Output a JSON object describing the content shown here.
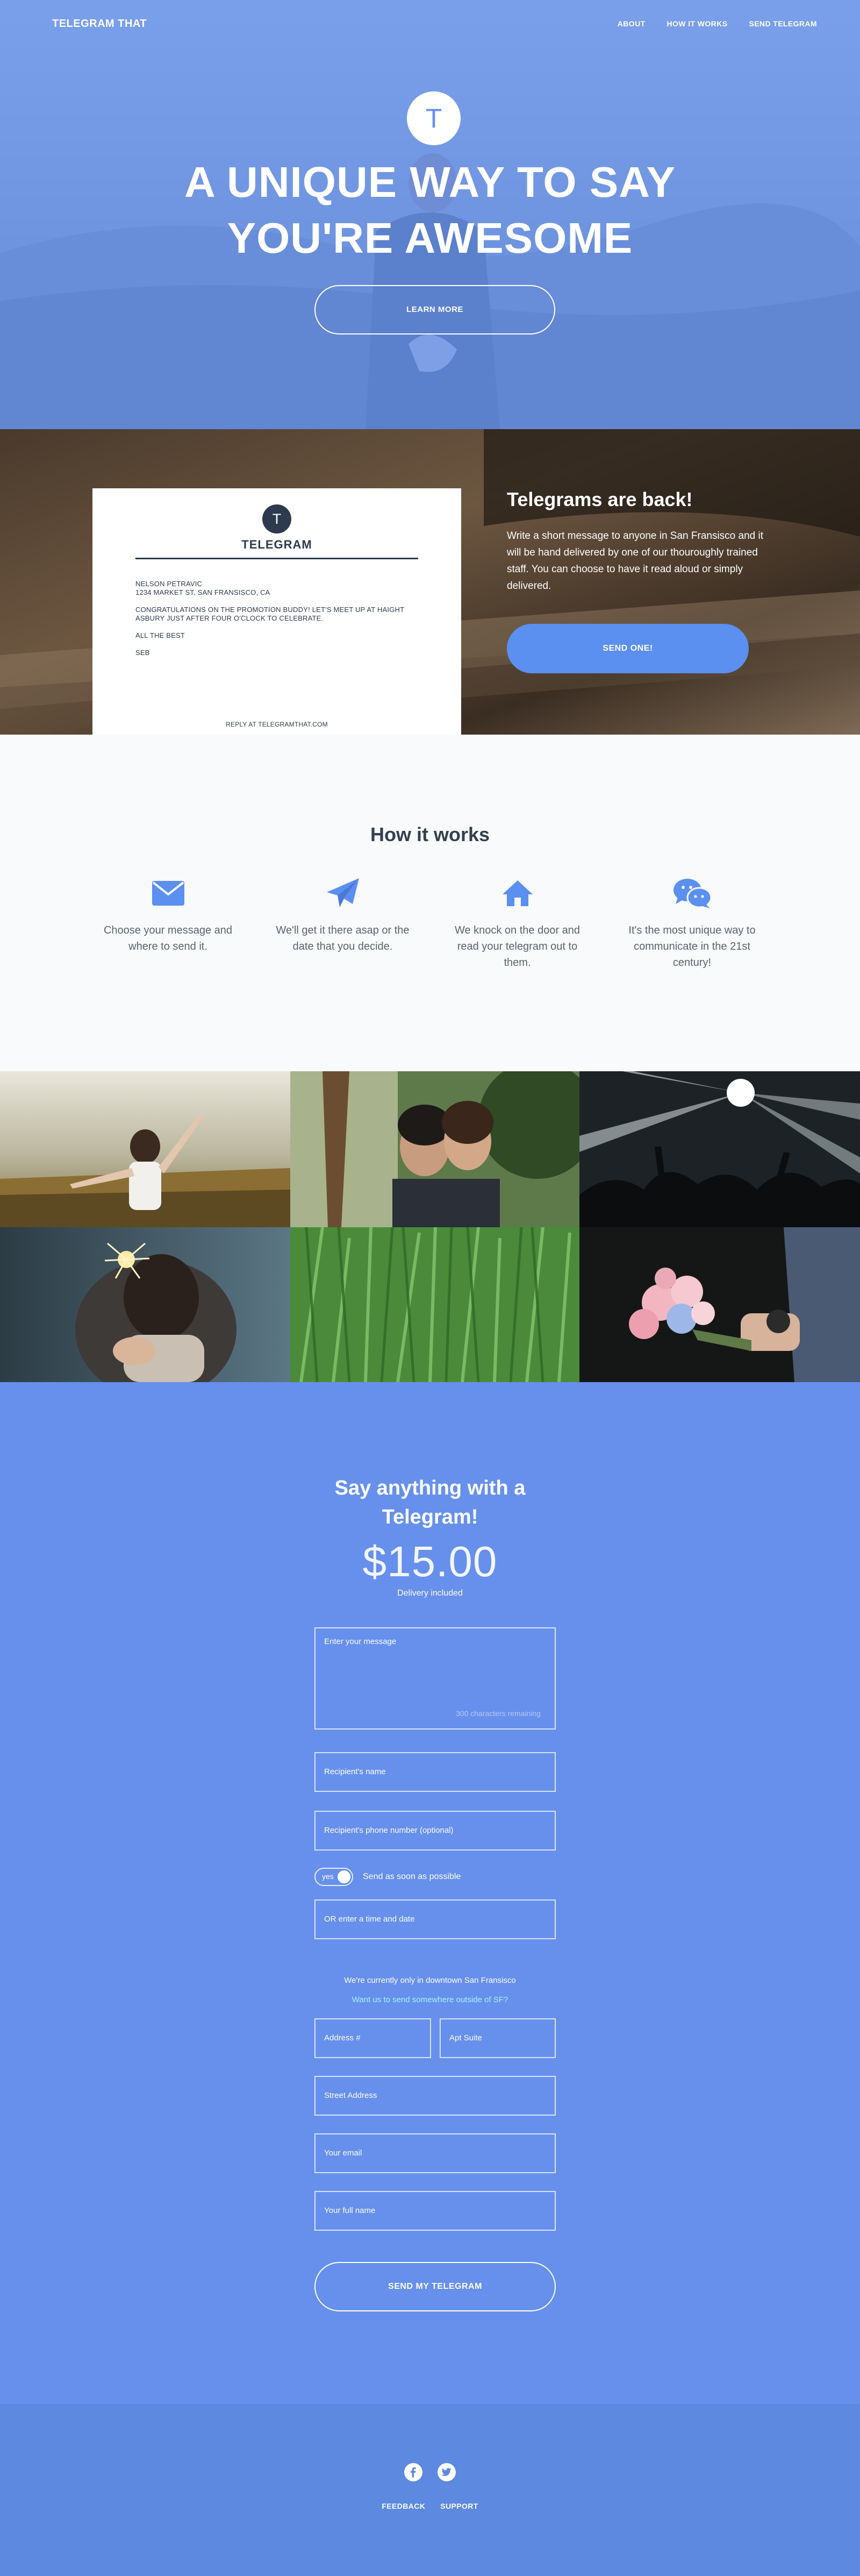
{
  "nav": {
    "brand": "TELEGRAM THAT",
    "links": [
      "ABOUT",
      "HOW IT WORKS",
      "SEND TELEGRAM"
    ]
  },
  "hero": {
    "logo_letter": "T",
    "title_line1": "A UNIQUE WAY TO SAY",
    "title_line2": "YOU'RE AWESOME",
    "cta": "LEARN MORE"
  },
  "telegram": {
    "card": {
      "logo_letter": "T",
      "title": "TELEGRAM",
      "recipient_name": "NELSON PETRAVIC",
      "recipient_address": "1234 MARKET ST, SAN FRANSISCO, CA",
      "message": "CONGRATULATIONS ON THE PROMOTION BUDDY! LET'S MEET UP AT HAIGHT ASBURY JUST AFTER FOUR O'CLOCK TO CELEBRATE.",
      "closing": "ALL THE BEST",
      "signature": "SEB",
      "reply": "REPLY AT TELEGRAMTHAT.COM"
    },
    "heading": "Telegrams are back!",
    "description": "Write a short message to anyone in San Fransisco and it will be hand delivered by one of our thouroughly trained staff. You can choose to have it read aloud or simply delivered.",
    "cta": "SEND ONE!"
  },
  "how": {
    "title": "How it works",
    "steps": [
      {
        "icon": "envelope-icon",
        "text": "Choose your message and where to send it."
      },
      {
        "icon": "paper-plane-icon",
        "text": "We'll get it there asap or the date that you decide."
      },
      {
        "icon": "house-icon",
        "text": "We knock on the door and read your telegram out to them."
      },
      {
        "icon": "chat-bubbles-icon",
        "text": "It's the most unique way to communicate in the 21st century!"
      }
    ]
  },
  "form": {
    "title": "Say anything with a Telegram!",
    "price": "$15.00",
    "price_note": "Delivery included",
    "message_placeholder": "Enter your message",
    "message_counter": "300 characters remaining",
    "recipient_name_placeholder": "Recipient's name",
    "recipient_phone_placeholder": "Recipient's phone number (optional)",
    "toggle_value": "yes",
    "toggle_label": "Send as soon as possible",
    "date_placeholder": "OR enter a time and date",
    "only_note": "We're currently only in downtown San Fransisco",
    "outside_link": "Want us to send somewhere outside of SF?",
    "address_placeholder": "Address #",
    "apt_placeholder": "Apt Suite",
    "street_placeholder": "Street Address",
    "email_placeholder": "Your email",
    "fullname_placeholder": "Your full name",
    "submit": "SEND MY TELEGRAM"
  },
  "footer": {
    "social": [
      "facebook-icon",
      "twitter-icon"
    ],
    "links": [
      "FEEDBACK",
      "SUPPORT"
    ]
  },
  "colors": {
    "brand_blue": "#6690ec",
    "button_blue": "#5b8ff0",
    "footer_blue": "#5d89e0",
    "dark_text": "#2e3a4d",
    "link_cyan": "#a6f0ff"
  }
}
